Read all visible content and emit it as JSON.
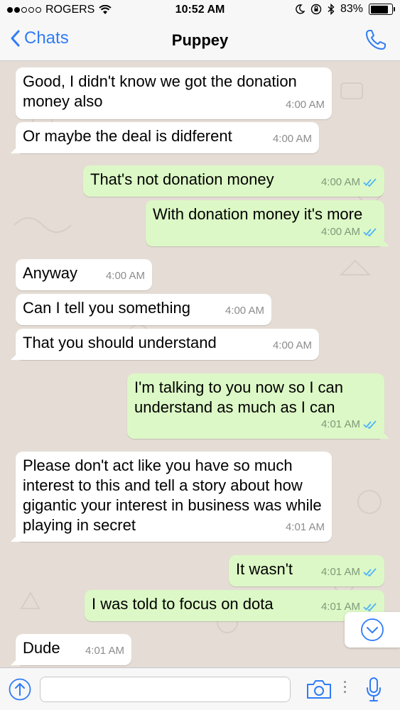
{
  "status_bar": {
    "carrier": "ROGERS",
    "time": "10:52 AM",
    "battery": "83%",
    "battery_level": 0.83
  },
  "nav": {
    "back_label": "Chats",
    "title": "Puppey"
  },
  "messages": [
    {
      "dir": "in",
      "text": "Good, I didn't know we got the donation money also",
      "time": "4:00 AM"
    },
    {
      "dir": "in",
      "text": "Or maybe the deal is didferent",
      "time": "4:00 AM"
    },
    {
      "dir": "out",
      "text": "That's not donation money",
      "time": "4:00 AM",
      "read": true
    },
    {
      "dir": "out",
      "text": "With donation money it's more",
      "time": "4:00 AM",
      "read": true
    },
    {
      "dir": "in",
      "text": "Anyway",
      "time": "4:00 AM"
    },
    {
      "dir": "in",
      "text": "Can I tell you something",
      "time": "4:00 AM"
    },
    {
      "dir": "in",
      "text": "That you should understand",
      "time": "4:00 AM"
    },
    {
      "dir": "out",
      "text": "I'm talking to you now so I can understand as much as I can",
      "time": "4:01 AM",
      "read": true
    },
    {
      "dir": "in",
      "text": "Please don't act like you have so much interest to this and tell a story about how gigantic your interest in business was while playing in secret",
      "time": "4:01 AM"
    },
    {
      "dir": "out",
      "text": "It wasn't",
      "time": "4:01 AM",
      "read": true
    },
    {
      "dir": "out",
      "text": "I was told to focus on dota",
      "time": "4:01 AM",
      "read": true
    },
    {
      "dir": "in",
      "text": "Dude",
      "time": "4:01 AM"
    }
  ],
  "icons": {
    "back": "chevron-left-icon",
    "call": "phone-icon",
    "scroll": "chevron-down-icon",
    "upload": "arrow-up-icon",
    "camera": "camera-icon",
    "mic": "microphone-icon",
    "ticks": "double-check-icon"
  },
  "colors": {
    "accent": "#2f7cf6",
    "incoming_bubble": "#ffffff",
    "outgoing_bubble": "#dcf8c6",
    "read_ticks": "#4fb3f6",
    "wallpaper": "#e5ddd5"
  },
  "input": {
    "value": "",
    "placeholder": ""
  }
}
